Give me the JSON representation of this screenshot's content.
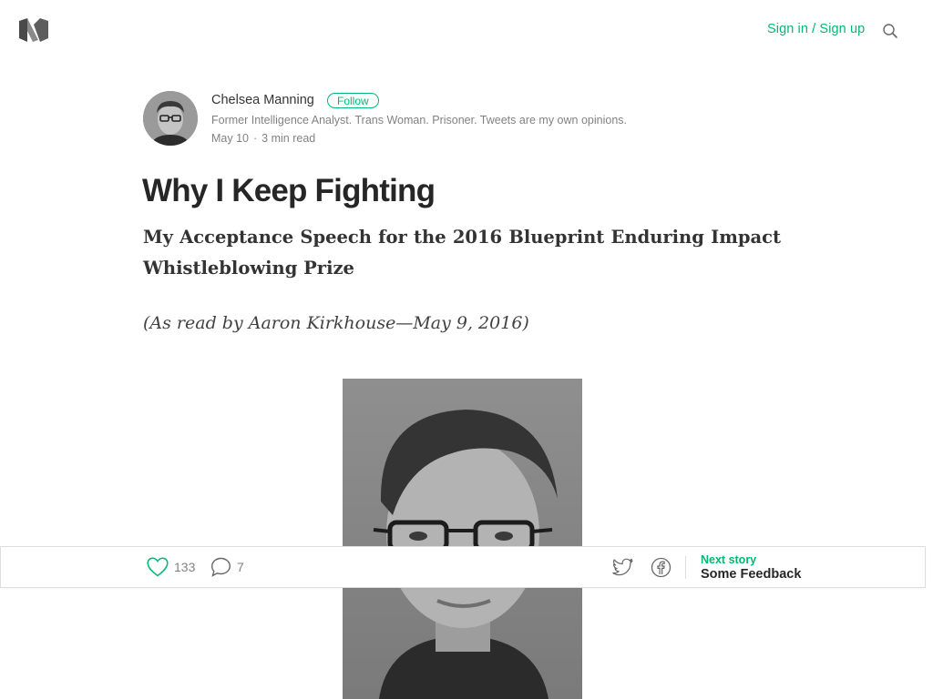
{
  "header": {
    "logo_icon": "medium-logo-icon",
    "signin_label": "Sign in / Sign up",
    "search_icon": "search-icon"
  },
  "author": {
    "name": "Chelsea Manning",
    "follow_label": "Follow",
    "bio": "Former Intelligence Analyst. Trans Woman. Prisoner. Tweets are my own opinions.",
    "date": "May 10",
    "separator": "·",
    "read_time": "3 min read"
  },
  "article": {
    "title": "Why I Keep Fighting",
    "subtitle": "My Acceptance Speech for the 2016 Blueprint Enduring Impact Whistleblowing Prize",
    "byline_quote": "(As read by Aaron Kirkhouse—May 9, 2016)"
  },
  "actions": {
    "recommend_icon": "heart-icon",
    "recommend_count": "133",
    "response_icon": "speech-bubble-icon",
    "response_count": "7",
    "twitter_icon": "twitter-icon",
    "facebook_icon": "facebook-icon",
    "next_story_label": "Next story",
    "next_story_title": "Some Feedback"
  },
  "colors": {
    "accent": "#02b875",
    "text": "#333333",
    "muted": "#808080"
  }
}
